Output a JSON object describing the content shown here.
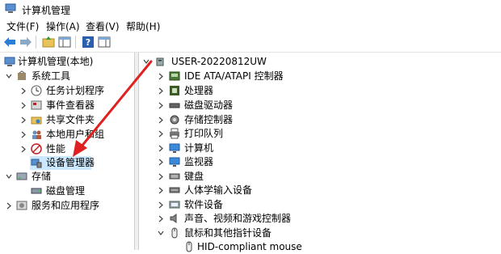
{
  "window": {
    "title": "计算机管理"
  },
  "menu": [
    "文件(F)",
    "操作(A)",
    "查看(V)",
    "帮助(H)"
  ],
  "left_tree": {
    "root": "计算机管理(本地)",
    "system_tools": "系统工具",
    "children": [
      "任务计划程序",
      "事件查看器",
      "共享文件夹",
      "本地用户和组",
      "性能",
      "设备管理器"
    ],
    "storage": "存储",
    "disk_mgmt": "磁盘管理",
    "services": "服务和应用程序"
  },
  "right_tree": {
    "root": "USER-20220812UW",
    "items": [
      "IDE ATA/ATAPI 控制器",
      "处理器",
      "磁盘驱动器",
      "存储控制器",
      "打印队列",
      "计算机",
      "监视器",
      "键盘",
      "人体学输入设备",
      "软件设备",
      "声音、视频和游戏控制器",
      "鼠标和其他指针设备"
    ],
    "sub_item": "HID-compliant mouse"
  },
  "colors": {
    "arrow": "#e02020",
    "selection": "#cce8ff"
  }
}
